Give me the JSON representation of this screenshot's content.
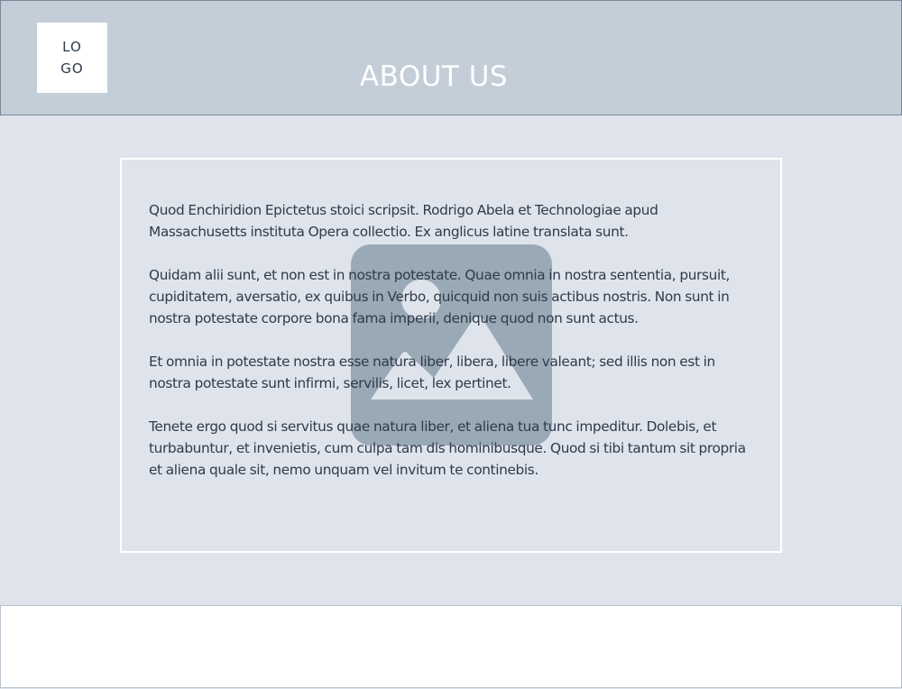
{
  "header": {
    "logo_text": "LOGO",
    "title": "ABOUT US"
  },
  "content": {
    "image_icon": "image-placeholder-icon",
    "paragraphs": [
      "Quod Enchiridion Epictetus stoici scripsit. Rodrigo Abela et Technologiae apud Massachusetts instituta Opera collectio. Ex anglicus latine translata sunt.",
      "Quidam alii sunt, et non est in nostra potestate. Quae omnia in nostra sententia, pursuit, cupiditatem, aversatio, ex quibus in Verbo, quicquid non suis actibus nostris. Non sunt in nostra potestate corpore bona fama imperii, denique quod non sunt actus.",
      "Et omnia in potestate nostra esse natura liber, libera, libere valeant; sed illis non est in nostra potestate sunt infirmi, servilis, licet, lex pertinet.",
      "Tenete ergo quod si servitus quae natura liber, et aliena tua tunc impeditur. Dolebis, et turbabuntur, et invenietis, cum culpa tam dis hominibusque. Quod si tibi tantum sit propria et aliena quale sit, nemo unquam vel invitum te continebis."
    ]
  },
  "colors": {
    "page_background": "#dfe4ec",
    "header_background": "#c3ced8",
    "text": "#2f3a4a",
    "placeholder_icon": "#9aa9b6",
    "footer_background": "#ffffff"
  }
}
